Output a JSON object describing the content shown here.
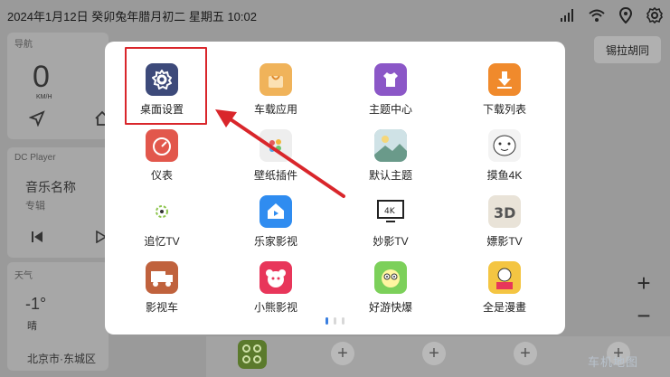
{
  "status_bar": {
    "datetime": "2024年1月12日  癸卯兔年腊月初二  星期五  10:02",
    "icons": [
      "signal-icon",
      "wifi-icon",
      "location-icon",
      "settings-gear-icon"
    ]
  },
  "background": {
    "nav_card": {
      "title": "导航",
      "speed": "0",
      "speed_unit": "KM/H"
    },
    "player_card": {
      "title": "DC Player",
      "song": "音乐名称",
      "album": "专辑"
    },
    "weather_card": {
      "title": "天气",
      "temp": "-1°",
      "condition": "晴",
      "city": "北京市·东城区"
    },
    "right_chip": "锡拉胡同",
    "zoom_in": "+",
    "zoom_out": "−",
    "dock_plus": "+"
  },
  "modal": {
    "apps": [
      {
        "label": "桌面设置",
        "icon": "gear-icon",
        "color": "#3d4a7a"
      },
      {
        "label": "车载应用",
        "icon": "shopping-bag-icon",
        "color": "#f0b35a"
      },
      {
        "label": "主题中心",
        "icon": "tshirt-icon",
        "color": "#8b57c7"
      },
      {
        "label": "下载列表",
        "icon": "download-arrow-icon",
        "color": "#f08a2c"
      },
      {
        "label": "仪表",
        "icon": "gauge-icon",
        "color": "#e2574c"
      },
      {
        "label": "壁纸插件",
        "icon": "palette-icon",
        "color": "#eeeeee"
      },
      {
        "label": "默认主题",
        "icon": "landscape-icon",
        "color": "#7aa7b0"
      },
      {
        "label": "摸鱼4K",
        "icon": "cartoon-character-icon",
        "color": "#f3f3f3"
      },
      {
        "label": "追忆TV",
        "icon": "tv-sparkle-icon",
        "color": "#ffffff"
      },
      {
        "label": "乐家影视",
        "icon": "home-play-icon",
        "color": "#2f8cf0"
      },
      {
        "label": "妙影TV",
        "icon": "tv-4k-icon",
        "color": "#ffffff"
      },
      {
        "label": "嫖影TV",
        "icon": "3d-glasses-icon",
        "color": "#e9e3d8"
      },
      {
        "label": "影视车",
        "icon": "film-truck-icon",
        "color": "#c0623d"
      },
      {
        "label": "小熊影视",
        "icon": "bear-icon",
        "color": "#e8365a"
      },
      {
        "label": "好游快爆",
        "icon": "game-face-icon",
        "color": "#7cd05a"
      },
      {
        "label": "全是漫畫",
        "icon": "manga-book-icon",
        "color": "#f4c542"
      }
    ],
    "pagination": {
      "pages": 3,
      "current": 1
    }
  },
  "annotation": {
    "highlight_color": "#d9262b"
  },
  "watermark": "车机地图"
}
